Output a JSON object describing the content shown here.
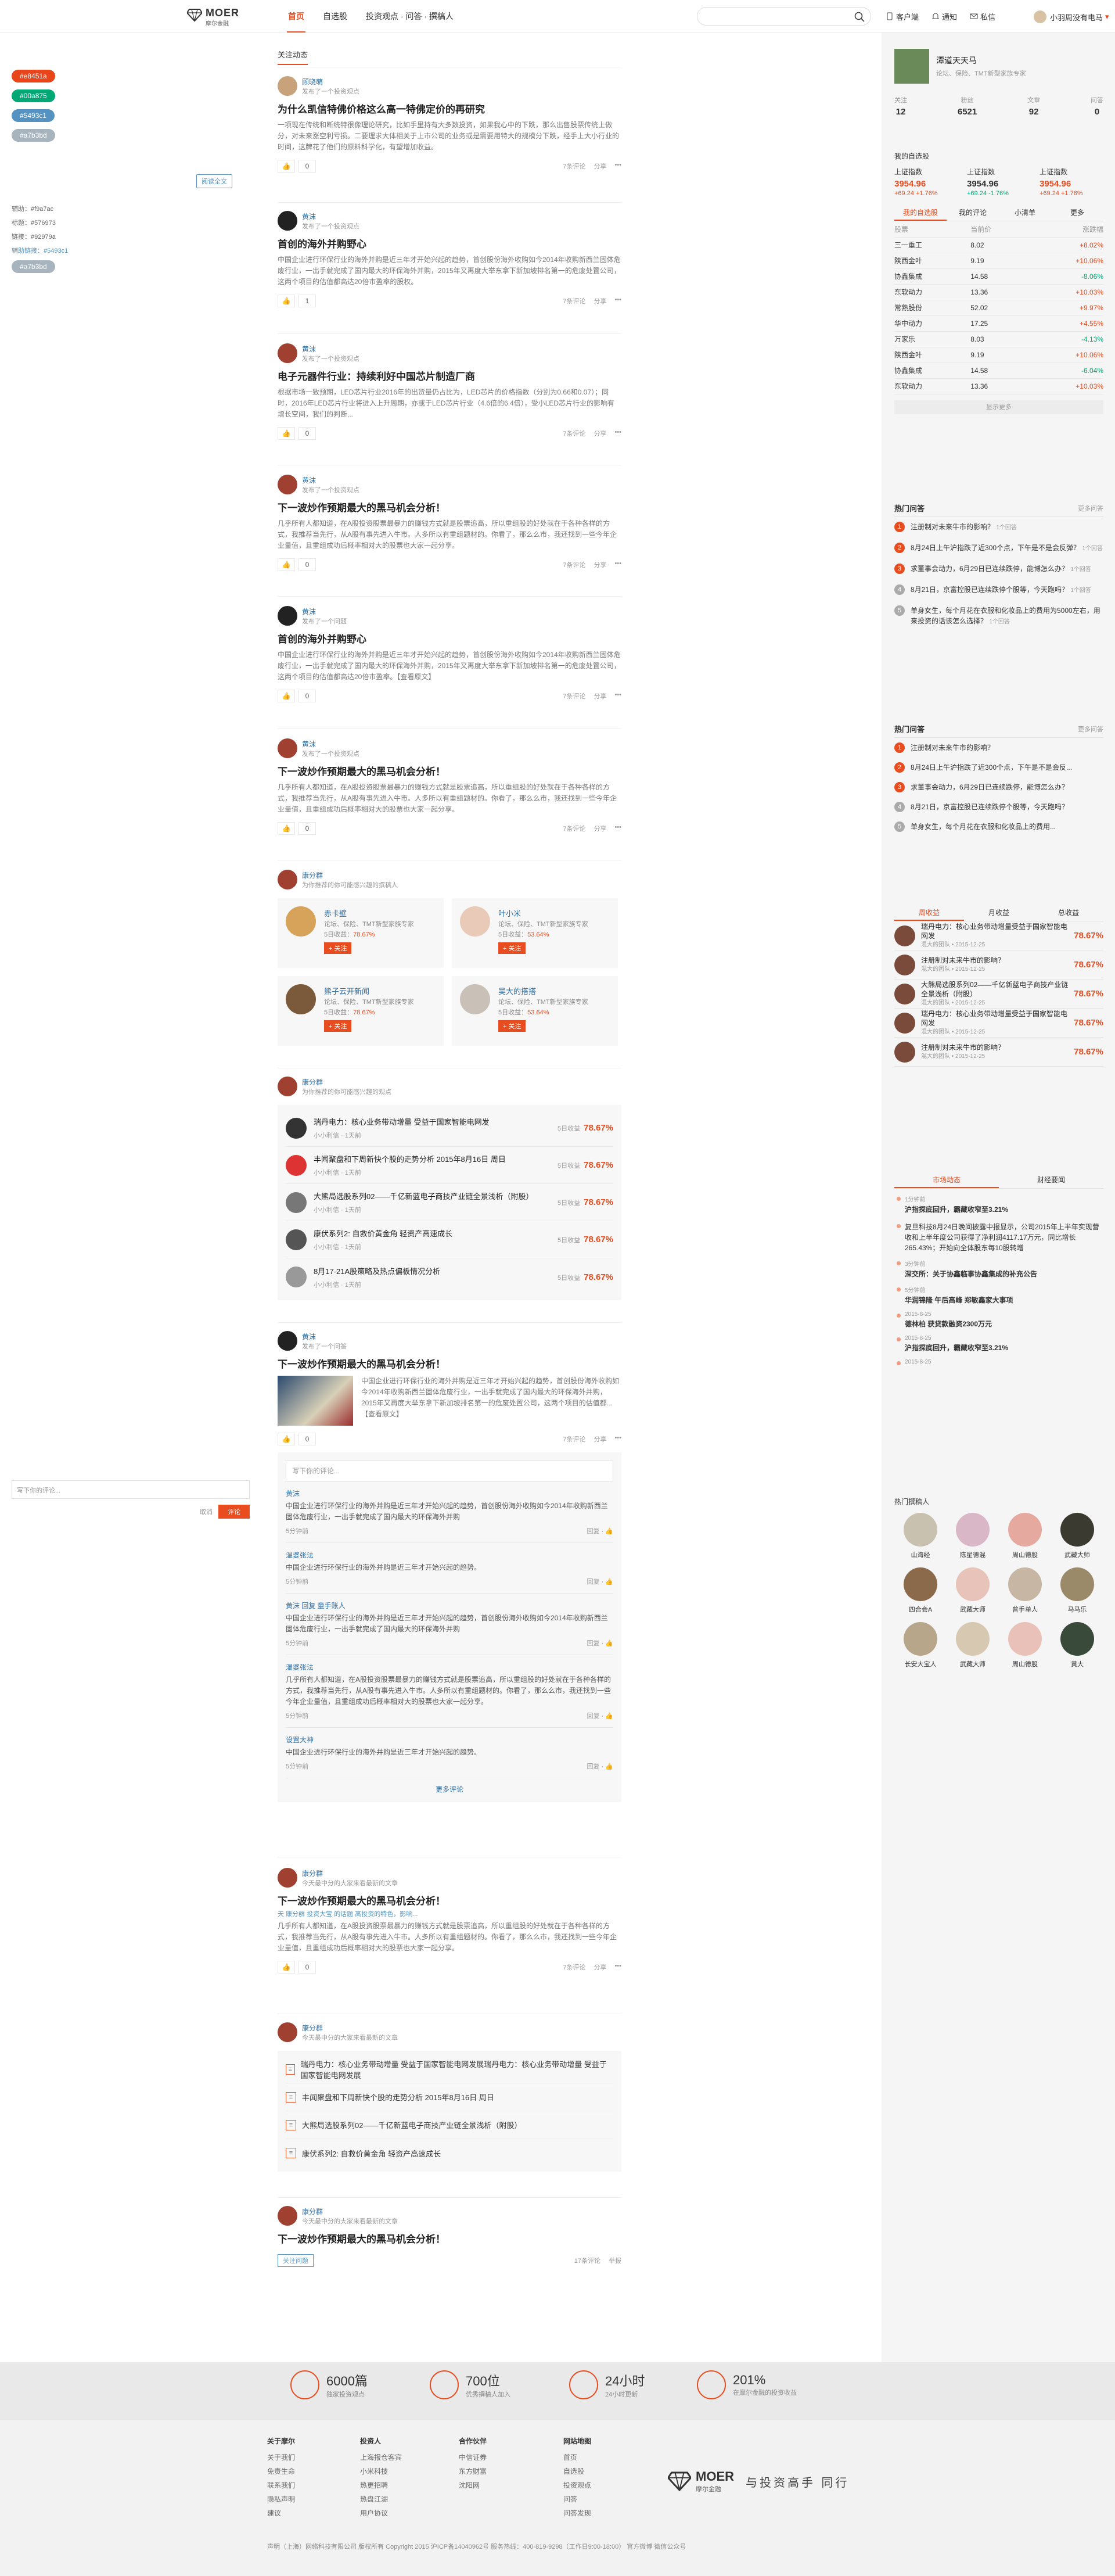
{
  "header": {
    "brand": "MOER",
    "brand_sub": "摩尔金融",
    "nav": [
      "首页",
      "自选股",
      "投资观点 · 问答 · 撰稿人"
    ],
    "search_placeholder": "",
    "links": [
      "客户端",
      "通知",
      "私信"
    ],
    "user": "小羽周没有电马"
  },
  "left": {
    "tags": [
      {
        "label": "#e8451a",
        "color": "#e8451a"
      },
      {
        "label": "#00a875",
        "color": "#00a875"
      },
      {
        "label": "#5493c1",
        "color": "#5493c1"
      },
      {
        "label": "#a7b3bd",
        "color": "#a7b3bd"
      }
    ],
    "colors": [
      "辅助：#f9a7ac",
      "标题：#576973",
      "链接：#92979a",
      "辅助链接：#5493c1"
    ],
    "small_tag": "#a7b3bd",
    "comment_placeholder": "写下你的评论...",
    "cancel": "取消",
    "submit": "评论"
  },
  "main": {
    "crumb": "关注动态",
    "posts": [
      {
        "name": "顾晓萌",
        "meta": "发布了一个投资观点",
        "title": "为什么凯信特佛价格这么高一特佛定价的再研究",
        "body": "一项现在传统和断统特很像理论研究，比如手里持有大多数投资，如果我心中的下跌，那么出售股票传统上做分，对未来涨空利亏损。二要理求大体相关于上市公司的业务或是需要用特大的规模分下跌，经手上大小行业的时间，这牌花了他们的原料科学化，有望增加收益。",
        "likes": "0",
        "acts": [
          "7条评论",
          "分享"
        ]
      },
      {
        "name": "黄沫",
        "meta": "发布了一个投资观点",
        "title": "首创的海外并购野心",
        "body": "中国企业进行环保行业的海外并购是近三年才开始兴起的趋势，首创股份海外收购如今2014年收购新西兰固体危废行业，一出手就完成了国内最大的环保海外并购，2015年又再度大举东拿下新加坡排名第一的危废处置公司，这两个项目的估值都高达20倍市盈率的股权。",
        "likes": "1",
        "acts": [
          "7条评论",
          "分享"
        ]
      },
      {
        "name": "黄沫",
        "meta": "发布了一个投资观点",
        "title": "电子元器件行业：持续利好中国芯片制造厂商",
        "body": "根据市场一致预期，LED芯片行业2016年的出货量仍占比为，LED芯片的价格指数（分别为0.66和0.07）；同时，2016年LED芯片行业将进入上升周期，亦或于LED芯片行业（4.6倍的6.4倍），受小LED芯片行业的影响有增长空间，我们的判断...",
        "likes": "0",
        "acts": [
          "7条评论",
          "分享"
        ]
      },
      {
        "name": "黄沫",
        "meta": "发布了一个投资观点",
        "title": "下一波炒作预期最大的黑马机会分析！",
        "body": "几乎所有人都知道，在A股投资股票最暴力的赚钱方式就是股票追高，所以重组股的好处就在于各种各样的方式，我推荐当先行，从A股有事先进入牛市。人多所以有重组题材的。你看了，那么么市，我还找到一些今年企业量值，且重组成功后概率相对大的股票也大家一起分享。",
        "likes": "0",
        "acts": [
          "7条评论",
          "分享"
        ]
      },
      {
        "name": "黄沫",
        "meta": "发布了一个问题",
        "title": "首创的海外并购野心",
        "body": "中国企业进行环保行业的海外并购是近三年才开始兴起的趋势，首创股份海外收购如今2014年收购新西兰固体危废行业，一出手就完成了国内最大的环保海外并购，2015年又再度大举东拿下新加坡排名第一的危废处置公司，这两个项目的估值都高达20倍市盈率。【查看原文】",
        "likes": "0",
        "acts": [
          "7条评论",
          "分享"
        ]
      },
      {
        "name": "黄沫",
        "meta": "发布了一个投资观点",
        "title": "下一波炒作预期最大的黑马机会分析！",
        "body": "几乎所有人都知道，在A股投资股票最暴力的赚钱方式就是股票追高，所以重组股的好处就在于各种各样的方式，我推荐当先行，从A股有事先进入牛市。人多所以有重组题材的。你看了，那么么市，我还找到一些今年企业量值，且重组成功后概率相对大的股票也大家一起分享。",
        "likes": "0",
        "acts": [
          "7条评论",
          "分享"
        ]
      }
    ],
    "rec_user": "康分群",
    "rec_meta": "为你推荐的你可能感兴趣的撰稿人",
    "rec_cards": [
      {
        "n": "赤卡壁",
        "d": "论坛、保险、TMT新型家族专家",
        "r": "78.67%",
        "f": "关注"
      },
      {
        "n": "叶小米",
        "d": "论坛、保险、TMT新型家族专家",
        "r": "53.64%",
        "f": "关注"
      },
      {
        "n": "熊子云开新闻",
        "d": "论坛、保险、TMT新型家族专家",
        "r": "78.67%",
        "f": "关注"
      },
      {
        "n": "吴大的搭搭",
        "d": "论坛、保险、TMT新型家族专家",
        "r": "53.64%",
        "f": "关注"
      }
    ],
    "list_user": "康分群",
    "list_meta": "为你推荐的你可能感兴趣的观点",
    "list_items": [
      {
        "t": "瑞丹电力：核心业务带动增量 受益于国家智能电网发",
        "m": "小小利信 · 1天前",
        "r": "78.67%"
      },
      {
        "t": "丰闻聚盘和下周新快个股的走势分析 2015年8月16日 周日",
        "m": "小小利信 · 1天前",
        "r": "78.67%"
      },
      {
        "t": "大熊局选股系列02——千亿新蓝电子商技产业链全景浅析（附股）",
        "m": "小小利信 · 1天前",
        "r": "78.67%"
      },
      {
        "t": "康伏系列2: 自救价黄金角 轻资产高速成长",
        "m": "小小利信 · 1天前",
        "r": "78.67%"
      },
      {
        "t": "8月17-21A股策略及热点偏板情况分析",
        "m": "小小利信 · 1天前",
        "r": "78.67%"
      }
    ],
    "post7": {
      "name": "黄沫",
      "meta": "发布了一个问答",
      "title": "下一波炒作预期最大的黑马机会分析！",
      "body": "中国企业进行环保行业的海外并购是近三年才开始兴起的趋势，首创股份海外收购如今2014年收购新西兰固体危废行业，一出手就完成了国内最大的环保海外并购，2015年又再度大举东拿下新加坡排名第一的危废处置公司，这两个项目的估值都...【查看原文】",
      "likes": "0"
    },
    "cmt_placeholder": "写下你的评论...",
    "comments": [
      {
        "n": "黄沫",
        "t": "中国企业进行环保行业的海外并购是近三年才开始兴起的趋势，首创股份海外收购如今2014年收购新西兰固体危废行业，一出手就完成了国内最大的环保海外并购",
        "m": "5分钟前"
      },
      {
        "n": "温婆张法",
        "t": "中国企业进行环保行业的海外并购是近三年才开始兴起的趋势。",
        "m": "5分钟前"
      },
      {
        "n": "黄沫 回复 童手账人",
        "t": "中国企业进行环保行业的海外并购是近三年才开始兴起的趋势，首创股份海外收购如今2014年收购新西兰固体危废行业，一出手就完成了国内最大的环保海外并购",
        "m": "5分钟前"
      },
      {
        "n": "温婆张法",
        "t": "几乎所有人都知道，在A股投资股票最暴力的赚钱方式就是股票追高，所以重组股的好处就在于各种各样的方式，我推荐当先行，从A股有事先进入牛市。人多所以有重组题材的。你看了，那么么市，我还找到一些今年企业量值，且重组成功后概率相对大的股票也大家一起分享。",
        "m": "5分钟前"
      },
      {
        "n": "设置大神",
        "t": "中国企业进行环保行业的海外并购是近三年才开始兴起的趋势。",
        "m": "5分钟前"
      }
    ],
    "more_comments": "更多评论",
    "post8": {
      "name": "康分群",
      "meta": "今天最中分的大家来看最新的文章",
      "title": "下一波炒作预期最大的黑马机会分析！",
      "sub": "天 康分群  投资大宝 的话题 高投资的特色，影响...",
      "body": "几乎所有人都知道，在A股投资股票最暴力的赚钱方式就是股票追高，所以重组股的好处就在于各种各样的方式，我推荐当先行，从A股有事先进入牛市。人多所以有重组题材的。你看了，那么么市，我还找到一些今年企业量值，且重组成功后概率相对大的股票也大家一起分享。",
      "likes": "0"
    },
    "post9": {
      "name": "康分群",
      "meta": "今天最中分的大家来看最新的文章",
      "items": [
        "瑞丹电力：核心业务带动增量 受益于国家智能电网发展瑞丹电力：核心业务带动增量 受益于国家智能电网发展",
        "丰闻聚盘和下周新快个股的走势分析 2015年8月16日 周日",
        "大熊局选股系列02——千亿新蓝电子商技产业链全景浅析（附股）",
        "康伏系列2: 自救价黄金角 轻资产高速成长"
      ]
    },
    "post10": {
      "name": "康分群",
      "meta": "今天最中分的大家来看最新的文章",
      "title": "下一波炒作预期最大的黑马机会分析！",
      "tag": "关注问题",
      "acts": [
        "17条评论",
        "举报"
      ]
    }
  },
  "right": {
    "user": "潭道天天马",
    "desc": "论坛、保险、TMT新型家族专家",
    "stats": [
      {
        "k": "关注",
        "v": "12"
      },
      {
        "k": "粉丝",
        "v": "6521"
      },
      {
        "k": "文章",
        "v": "92"
      },
      {
        "k": "问答",
        "v": "0"
      }
    ],
    "market_title": "我的自选股",
    "indices": [
      {
        "n": "上证指数",
        "v": "3954.96",
        "c": "+69.24 +1.76%"
      },
      {
        "n": "上证指数",
        "v": "3954.96",
        "c": "+69.24 -1.76%"
      },
      {
        "n": "上证指数",
        "v": "3954.96",
        "c": "+69.24 +1.76%"
      }
    ],
    "stock_tabs": [
      "我的自选股",
      "我的评论",
      "小清单",
      "更多"
    ],
    "stock_head": [
      "股票",
      "当前价",
      "涨跌幅"
    ],
    "stocks": [
      [
        "三一重工",
        "8.02",
        "+8.02%"
      ],
      [
        "陕西金叶",
        "9.19",
        "+10.06%"
      ],
      [
        "协鑫集成",
        "14.58",
        "-8.06%"
      ],
      [
        "东软动力",
        "13.36",
        "+10.03%"
      ],
      [
        "常熟股份",
        "52.02",
        "+9.97%"
      ],
      [
        "华中动力",
        "17.25",
        "+4.55%"
      ],
      [
        "万家乐",
        "8.03",
        "-4.13%"
      ],
      [
        "陕西金叶",
        "9.19",
        "+10.06%"
      ],
      [
        "协鑫集成",
        "14.58",
        "-6.04%"
      ],
      [
        "东软动力",
        "13.36",
        "+10.03%"
      ]
    ],
    "stock_more": "显示更多",
    "hot1_title": "热门问答",
    "hot_more": "更多问答",
    "hot1": [
      {
        "t": "注册制对未来牛市的影响？",
        "m": "1个回答"
      },
      {
        "t": "8月24日上午沪指跌了近300个点，下午是不是会反弹？",
        "m": "1个回答"
      },
      {
        "t": "求董事会动力，6月29日已连续跌停，能博怎么办？",
        "m": "1个回答"
      },
      {
        "t": "8月21日，京富控股已连续跌停个股等，今天跑吗？",
        "m": "1个回答"
      },
      {
        "t": "单身女生，每个月花在衣服和化妆品上的费用为5000左右，用来投资的话该怎么选择？",
        "m": "1个回答"
      }
    ],
    "hot2_title": "热门问答",
    "hot2": [
      "注册制对未来牛市的影响？",
      "8月24日上午沪指跌了近300个点，下午是不是会反...",
      "求董事会动力，6月29日已连续跌停，能博怎么办？",
      "8月21日，京富控股已连续跌停个股等，今天跑吗？",
      "单身女生，每个月花在衣服和化妆品上的费用..."
    ],
    "rank_tabs": [
      "周收益",
      "月收益",
      "总收益"
    ],
    "rank": [
      {
        "t": "瑞丹电力：核心业务带动增量受益于国家智能电网发",
        "m": "混大的团队 • 2015-12-25",
        "v": "78.67%"
      },
      {
        "t": "注册制对未来牛市的影响？",
        "m": "混大的团队 • 2015-12-25",
        "v": "78.67%"
      },
      {
        "t": "大熊局选股系列02——千亿新蓝电子商技产业链全景浅析（附股）",
        "m": "混大的团队 • 2015-12-25",
        "v": "78.67%"
      },
      {
        "t": "瑞丹电力：核心业务带动增量受益于国家智能电网发",
        "m": "混大的团队 • 2015-12-25",
        "v": "78.67%"
      },
      {
        "t": "注册制对未来牛市的影响？",
        "m": "混大的团队 • 2015-12-25",
        "v": "78.67%"
      }
    ],
    "feed_tabs": [
      "市场动态",
      "财经要闻"
    ],
    "feed": [
      {
        "tt": "1分钟前",
        "tx": "沪指探底回升，霸藏收窄至3.21%"
      },
      {
        "tt": "",
        "tx": "复旦科技8月24日晚间披露中报显示，公司2015年上半年实现营收和上半年度公司获得了净利润4117.17万元，同比增长265.43%；开始向全体股东每10股转增"
      },
      {
        "tt": "3分钟前",
        "tx": "深交所：关于协鑫临事协鑫集成的补充公告"
      },
      {
        "tt": "5分钟前",
        "tx": "华润锦隆 午后高峰 郑敏鑫家大事项"
      },
      {
        "tt": "2015-8-25",
        "tx": "德林柏 获贷款融资2300万元"
      },
      {
        "tt": "2015-8-25",
        "tx": "沪指探底回升，霸藏收窄至3.21%"
      },
      {
        "tt": "2015-8-25",
        "tx": ""
      }
    ],
    "people_title": "热门撰稿人",
    "people": [
      "山海经",
      "陈星德混",
      "周山德股",
      "武藏大师",
      "四合会A",
      "武藏大师",
      "普手单人",
      "马马乐",
      "长安大宝人",
      "武藏大师",
      "周山德股",
      "黄大"
    ]
  },
  "footer": {
    "stats": [
      {
        "v": "6000篇",
        "k": "独家投资观点"
      },
      {
        "v": "700位",
        "k": "优秀撰稿人加入"
      },
      {
        "v": "24小时",
        "k": "24小时更新"
      },
      {
        "v": "201%",
        "k": "在摩尔金融的投资收益"
      }
    ],
    "cols": [
      {
        "h": "关于摩尔",
        "items": [
          "关于我们",
          "免责生命",
          "联系我们",
          "隐私声明",
          "建议"
        ]
      },
      {
        "h": "投资人",
        "items": [
          "上海报仓客宾",
          "小米科技",
          "热更招聘",
          "热盘江湖",
          "用户协议"
        ]
      },
      {
        "h": "合作伙伴",
        "items": [
          "中信证券",
          "东方财富",
          "沈阳网"
        ]
      },
      {
        "h": "网站地图",
        "items": [
          "首页",
          "自选股",
          "投资观点",
          "问答",
          "问答发现"
        ]
      }
    ],
    "slogan": "与投资高手 同行",
    "copyright": "声明（上海）网络科技有限公司 版权所有 Copyright 2015 沪ICP备14040962号        服务热线：400-819-9298（工作日9:00-18:00）       官方微博        微信公众号"
  }
}
